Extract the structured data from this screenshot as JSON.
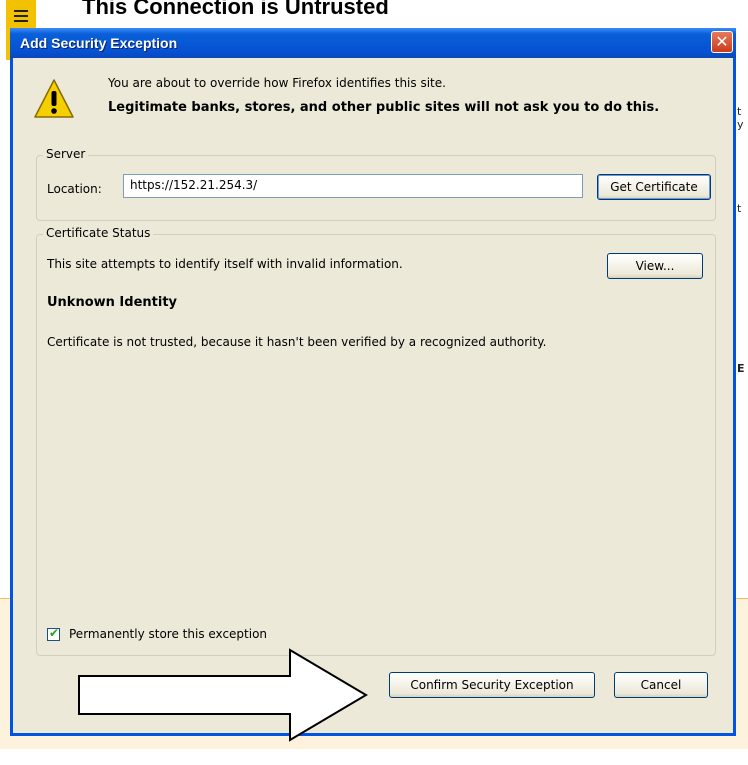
{
  "background_page": {
    "heading": "This Connection is Untrusted",
    "side_fragments": [
      "t y",
      "t",
      "E"
    ]
  },
  "dialog": {
    "title": "Add Security Exception",
    "close_label": "✕",
    "intro_line1": "You are about to override how Firefox identifies this site.",
    "intro_line2": "Legitimate banks, stores, and other public sites will not ask you to do this.",
    "server": {
      "legend": "Server",
      "location_label": "Location:",
      "location_value": "https://152.21.254.3/",
      "get_certificate_label": "Get Certificate"
    },
    "certificate_status": {
      "legend": "Certificate Status",
      "message": "This site attempts to identify itself with invalid information.",
      "view_label": "View...",
      "identity_heading": "Unknown Identity",
      "detail": "Certificate is not trusted, because it hasn't been verified by a recognized authority.",
      "permanent_store_label": "Permanently store this exception",
      "permanent_store_checked": true
    },
    "buttons": {
      "confirm_label": "Confirm Security Exception",
      "cancel_label": "Cancel"
    }
  },
  "colors": {
    "titlebar": "#0551d3",
    "dialog_bg": "#ece9d8",
    "warning_yellow": "#f2c200"
  },
  "icons": [
    "warning-icon",
    "close-icon",
    "checkmark-icon",
    "arrow-icon"
  ]
}
